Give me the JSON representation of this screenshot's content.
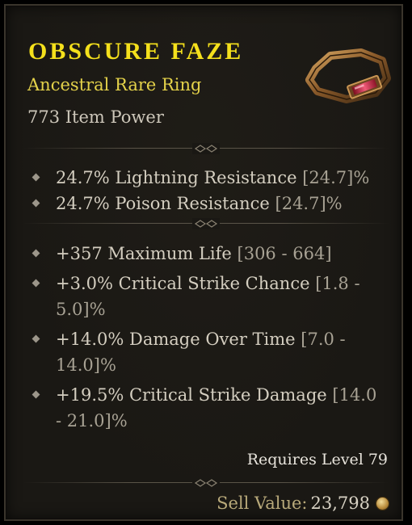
{
  "item": {
    "name": "OBSCURE FAZE",
    "subtitle": "Ancestral Rare Ring",
    "item_power": "773 Item Power",
    "image_icon": "ring-icon"
  },
  "implicit_affixes": [
    {
      "text": "24.7% Lightning Resistance",
      "range": "[24.7]%"
    },
    {
      "text": "24.7% Poison Resistance",
      "range": "[24.7]%"
    }
  ],
  "affixes": [
    {
      "text": "+357 Maximum Life",
      "range": "[306 - 664]"
    },
    {
      "text": "+3.0% Critical Strike Chance",
      "range": "[1.8 - 5.0]%"
    },
    {
      "text": "+14.0% Damage Over Time",
      "range": "[7.0 - 14.0]%"
    },
    {
      "text": "+19.5% Critical Strike Damage",
      "range": "[14.0 - 21.0]%"
    }
  ],
  "requirements": {
    "level_text": "Requires Level 79"
  },
  "sell": {
    "label": "Sell Value:",
    "value": "23,798",
    "icon": "gold-coin-icon"
  },
  "colors": {
    "name": "#f4e01c",
    "rarity": "#e4d24a",
    "background": "#1a1814"
  }
}
